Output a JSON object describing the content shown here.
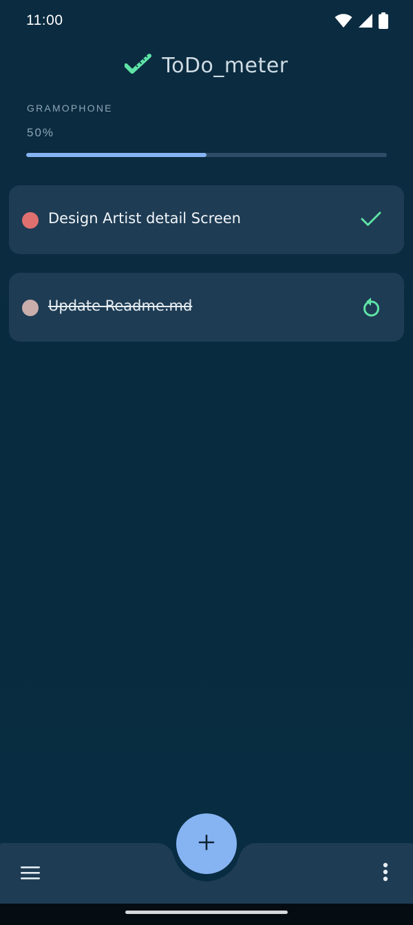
{
  "status_bar": {
    "time": "11:00",
    "icons": [
      "wifi-icon",
      "signal-icon",
      "battery-icon"
    ]
  },
  "header": {
    "title": "ToDo_meter",
    "logo_icon": "ruler-check-icon"
  },
  "project": {
    "name": "GRAMOPHONE",
    "progress_label": "50%",
    "progress_fraction": 0.5
  },
  "tasks": [
    {
      "text": "Design Artist detail Screen",
      "done": false,
      "dot_color": "#e0706f",
      "action_icon": "check-icon"
    },
    {
      "text": "Update Readme.md",
      "done": true,
      "dot_color": "#c9aeab",
      "action_icon": "undo-icon"
    }
  ],
  "bottom_bar": {
    "menu_icon": "hamburger-menu-icon",
    "more_icon": "more-vertical-icon",
    "fab_icon": "add-icon"
  },
  "colors": {
    "background": "#0b2a3d",
    "card": "#1e3c54",
    "accent_blue": "#86b3f2",
    "accent_green": "#5fe3a6",
    "bottom_bar": "#1e3c54"
  }
}
